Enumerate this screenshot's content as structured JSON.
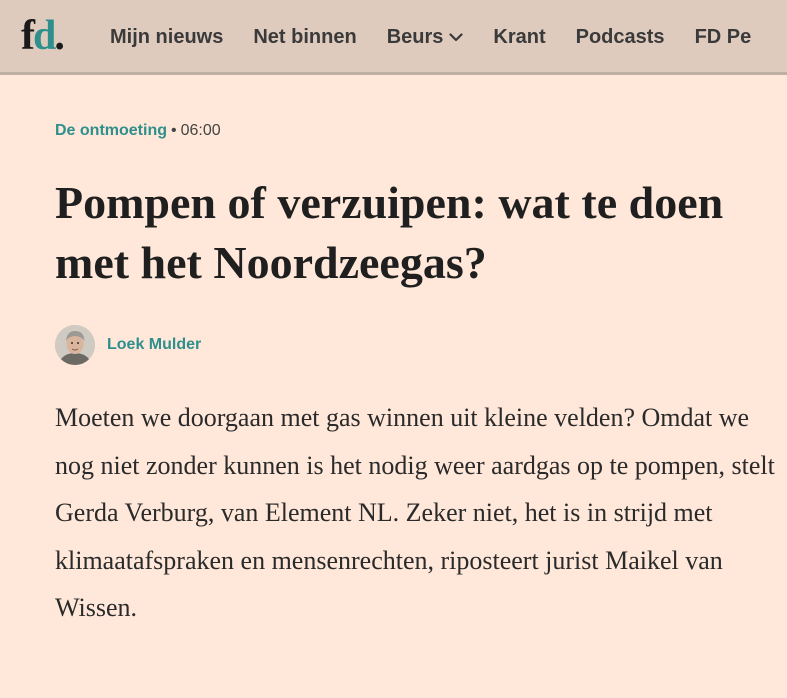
{
  "logo": {
    "letter_f": "f",
    "letter_d": "d",
    "dot": "."
  },
  "nav": {
    "items": [
      {
        "label": "Mijn nieuws"
      },
      {
        "label": "Net binnen"
      },
      {
        "label": "Beurs",
        "icon": "chevron-down-icon"
      },
      {
        "label": "Krant"
      },
      {
        "label": "Podcasts"
      },
      {
        "label": "FD Pe"
      }
    ]
  },
  "article": {
    "section": "De ontmoeting",
    "separator": "•",
    "time": "06:00",
    "headline": "Pompen of verzuipen: wat te doen met het Noordzeegas?",
    "author": "Loek Mulder",
    "intro": "Moeten we doorgaan met gas winnen uit kleine velden? Omdat we nog niet zonder kunnen is het nodig weer aardgas op te pompen, stelt Gerda Verburg, van Element NL. Zeker niet, het is in strijd met klimaatafspraken en mensenrechten, riposteert jurist Maikel van Wissen."
  },
  "colors": {
    "background": "#ffe8da",
    "nav_background": "#dfcbbe",
    "accent": "#2f8f8c",
    "text": "#1a1a1a"
  }
}
